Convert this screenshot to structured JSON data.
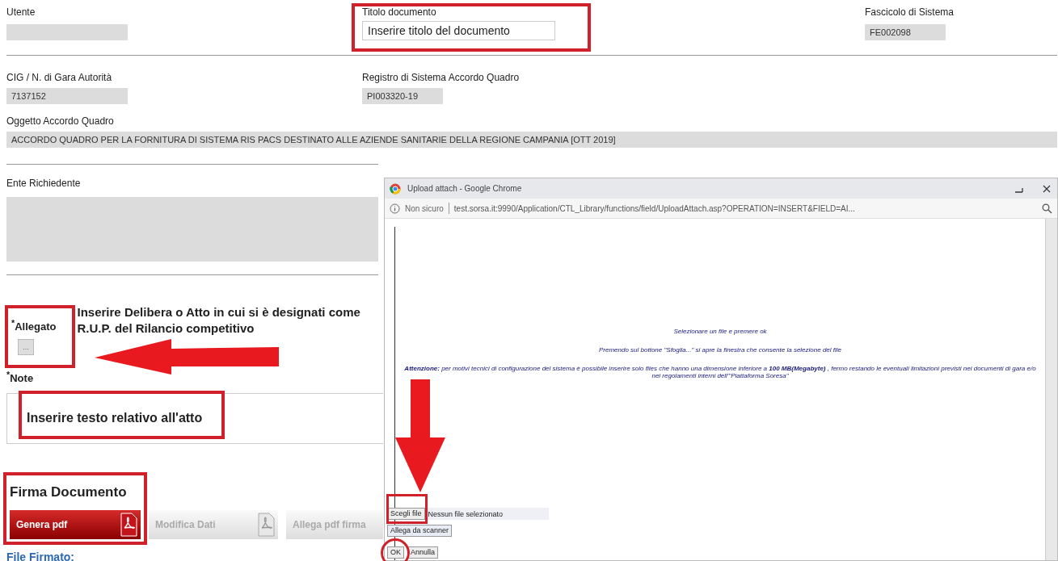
{
  "top_fields": [
    {
      "label": "Utente",
      "kind": "readonly"
    },
    {
      "label": "Titolo documento",
      "kind": "input",
      "value": "Inserire titolo del documento"
    },
    {
      "label": "Fascicolo di Sistema",
      "kind": "readonly",
      "value": "FE002098"
    }
  ],
  "second_fields": [
    {
      "label": "CIG / N. di Gara Autorità",
      "value": "7137152"
    },
    {
      "label": "Registro di Sistema Accordo Quadro",
      "value": "PI003320-19"
    }
  ],
  "oggetto": {
    "label": "Oggetto Accordo Quadro",
    "value": "ACCORDO QUADRO PER LA FORNITURA DI SISTEMA RIS PACS DESTINATO ALLE AZIENDE SANITARIE DELLA REGIONE CAMPANIA [OTT 2019]"
  },
  "ente": {
    "label": "Ente Richiedente"
  },
  "allegato": {
    "label": "$^{*}$Allegato",
    "button": "..."
  },
  "callout": "Inserire Delibera o Atto in cui si è designati come R.U.P. del Rilancio competitivo",
  "note": {
    "label": "$^{*}$Note",
    "value": "Inserire testo relativo all'atto"
  },
  "firma": {
    "title": "Firma Documento",
    "buttons": [
      {
        "label": "Genera pdf",
        "active": true,
        "kind": "pdf"
      },
      {
        "label": "Modifica Dati",
        "active": false,
        "kind": "pdf"
      },
      {
        "label": "Allega pdf firma",
        "active": false,
        "kind": "plain"
      }
    ]
  },
  "file_firmato": "File Firmato:",
  "dialog": {
    "title": "Upload attach - Google Chrome",
    "security": "Non sicuro",
    "url": "test.sorsa.it:9990/Application/CTL_Library/functions/field/UploadAttach.asp?OPERATION=INSERT&FIELD=AI...",
    "lines": [
      "Selezionare un file e premere ok",
      "Premendo sul bottone \"Sfoglia...\" si apre la finestra che consente la selezione del file",
      "**Attenzione:** per motivi tecnici di configurazione del sistema è possibile inserire solo files che hanno una dimensione inferiore a **100 MB(Megabyte)** , fermo restando le eventuali limitazioni previsti nei documenti di gara e/o nei regolamenti interni dell'\"Piattaforma Soresa\""
    ],
    "choose_button": "Scegli file",
    "file_status": "Nessun file selezionato",
    "scanner_button": "Allega da scanner",
    "buttons": [
      "OK",
      "Annulla"
    ]
  }
}
